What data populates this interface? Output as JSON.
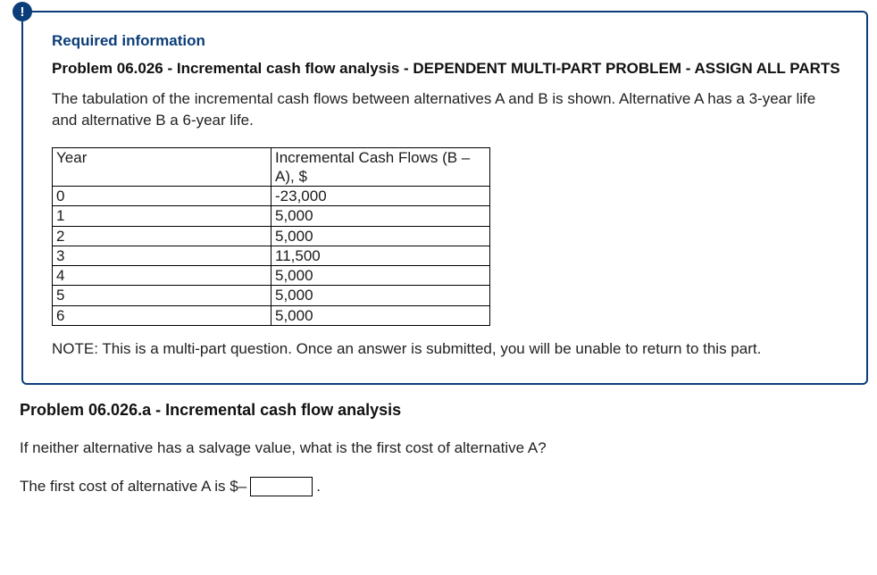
{
  "badge_symbol": "!",
  "required_heading": "Required information",
  "problem_heading": "Problem 06.026 - Incremental cash flow analysis - DEPENDENT MULTI-PART PROBLEM - ASSIGN ALL PARTS",
  "intro_text": "The tabulation of the incremental cash flows between alternatives A and B is shown. Alternative A has a 3-year life and alternative B a 6-year life.",
  "table": {
    "header_year": "Year",
    "header_value": "Incremental Cash Flows (B – A), $",
    "rows": [
      {
        "year": "0",
        "value": "-23,000"
      },
      {
        "year": "1",
        "value": "5,000"
      },
      {
        "year": "2",
        "value": "5,000"
      },
      {
        "year": "3",
        "value": "11,500"
      },
      {
        "year": "4",
        "value": "5,000"
      },
      {
        "year": "5",
        "value": "5,000"
      },
      {
        "year": "6",
        "value": "5,000"
      }
    ]
  },
  "note_text": "NOTE: This is a multi-part question. Once an answer is submitted, you will be unable to return to this part.",
  "sub_heading": "Problem 06.026.a - Incremental cash flow analysis",
  "question_text": "If neither alternative has a salvage value, what is the first cost of alternative A?",
  "answer_prefix": "The first cost of alternative A is $–",
  "answer_suffix": ".",
  "answer_value": ""
}
